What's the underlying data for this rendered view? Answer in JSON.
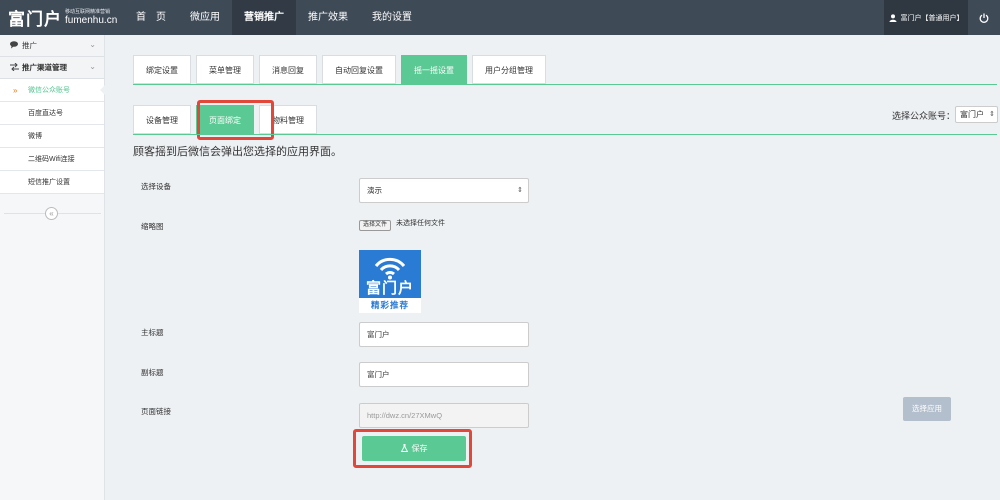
{
  "brand": {
    "name": "富门户",
    "tagline": "移动互联网精准营销",
    "url": "fumenhu.cn"
  },
  "nav": [
    "首　页",
    "微应用",
    "营销推广",
    "推广效果",
    "我的设置"
  ],
  "nav_active_index": 2,
  "user": {
    "label": "富门户【普通用户】"
  },
  "sidebar": {
    "groups": [
      {
        "label": "推广",
        "icon": "comments-icon"
      },
      {
        "label": "推广渠道管理",
        "icon": "exchange-icon"
      }
    ],
    "items": [
      "微信公众账号",
      "百度直达号",
      "微博",
      "二维码Wifi连接",
      "短信推广设置"
    ],
    "active_index": 0
  },
  "tabs_primary": [
    "绑定设置",
    "菜单管理",
    "消息回复",
    "自动回复设置",
    "摇一摇设置",
    "用户分组管理"
  ],
  "tabs_primary_active": 4,
  "tabs_secondary": [
    "设备管理",
    "页面绑定",
    "物料管理"
  ],
  "tabs_secondary_active": 1,
  "account": {
    "label": "选择公众账号：",
    "value": "富门户"
  },
  "description": "顾客摇到后微信会弹出您选择的应用界面。",
  "form": {
    "device_label": "选择设备",
    "device_value": "演示",
    "thumb_label": "缩略图",
    "file_button": "选择文件",
    "file_status": "未选择任何文件",
    "thumb_image": {
      "top_text": "富门户",
      "bottom_text": "精彩推荐"
    },
    "title_label": "主标题",
    "title_value": "富门户",
    "subtitle_label": "副标题",
    "subtitle_value": "富门户",
    "link_label": "页面链接",
    "link_value": "http://dwz.cn/27XMwQ",
    "pick_app_button": "选择应用",
    "save_button": "保存"
  },
  "colors": {
    "accent": "#5bc993",
    "topbar": "#3f4a57",
    "highlight": "#e2483a"
  }
}
